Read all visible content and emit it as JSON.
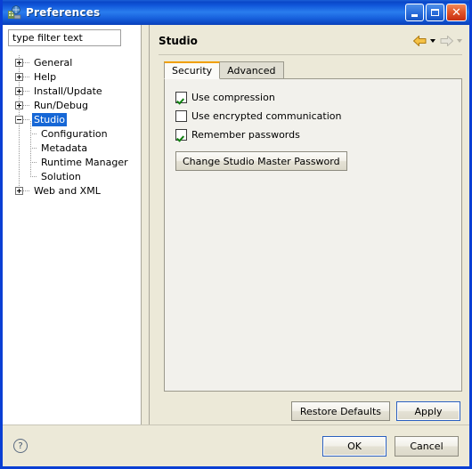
{
  "window": {
    "title": "Preferences",
    "app_icon": "preferences-app-icon",
    "controls": {
      "minimize": "minimize-icon",
      "maximize": "maximize-icon",
      "close": "close-icon"
    }
  },
  "filter": {
    "value": "type filter text",
    "placeholder": "type filter text"
  },
  "tree": {
    "items": [
      {
        "label": "General",
        "level": 0,
        "expander": "plus",
        "selected": false
      },
      {
        "label": "Help",
        "level": 0,
        "expander": "plus",
        "selected": false
      },
      {
        "label": "Install/Update",
        "level": 0,
        "expander": "plus",
        "selected": false
      },
      {
        "label": "Run/Debug",
        "level": 0,
        "expander": "plus",
        "selected": false
      },
      {
        "label": "Studio",
        "level": 0,
        "expander": "minus",
        "selected": true
      },
      {
        "label": "Configuration",
        "level": 1,
        "expander": "none",
        "selected": false
      },
      {
        "label": "Metadata",
        "level": 1,
        "expander": "none",
        "selected": false
      },
      {
        "label": "Runtime Manager",
        "level": 1,
        "expander": "none",
        "selected": false
      },
      {
        "label": "Solution",
        "level": 1,
        "expander": "none",
        "selected": false
      },
      {
        "label": "Web and XML",
        "level": 0,
        "expander": "plus",
        "selected": false
      }
    ]
  },
  "page": {
    "title": "Studio",
    "nav": {
      "back_icon": "back-arrow-icon",
      "back_enabled": true,
      "forward_icon": "forward-arrow-icon",
      "forward_enabled": false
    },
    "tabs": [
      {
        "label": "Security",
        "active": true
      },
      {
        "label": "Advanced",
        "active": false
      }
    ],
    "checkboxes": [
      {
        "label": "Use compression",
        "checked": true
      },
      {
        "label": "Use encrypted communication",
        "checked": false
      },
      {
        "label": "Remember passwords",
        "checked": true
      }
    ],
    "change_password_button": "Change Studio Master Password"
  },
  "apply_row": {
    "restore_defaults": "Restore Defaults",
    "apply": "Apply"
  },
  "footer": {
    "help_icon": "help-icon",
    "help_glyph": "?",
    "ok": "OK",
    "cancel": "Cancel"
  },
  "colors": {
    "titlebar_blue": "#0a47c8",
    "window_border": "#0a3fd4",
    "dialog_bg": "#ece9d8",
    "tree_bg": "#ffffff",
    "panel_bg": "#f2f1ec",
    "selection_blue": "#1667d6",
    "tab_accent_orange": "#f0a000",
    "check_green": "#108010",
    "close_red": "#c62e10"
  }
}
